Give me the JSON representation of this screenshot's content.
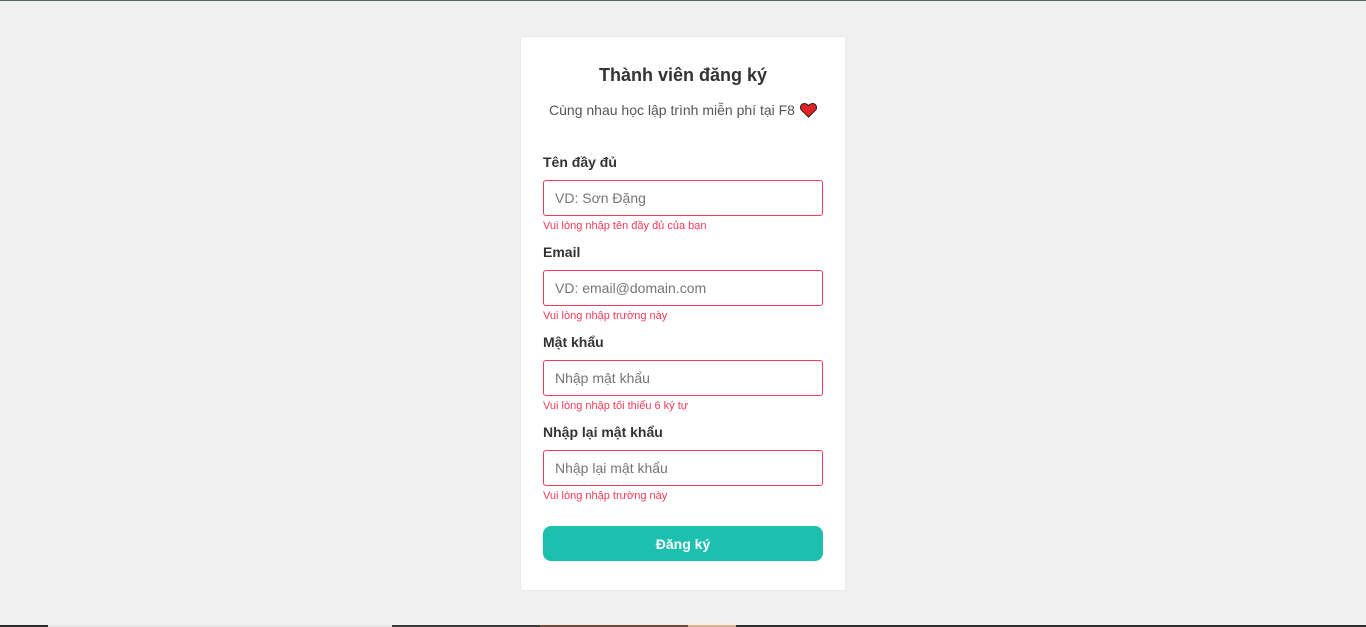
{
  "form": {
    "title": "Thành viên đăng ký",
    "description": "Cùng nhau học lập trình miễn phí tại F8",
    "fields": [
      {
        "label": "Tên đầy đủ",
        "placeholder": "VD: Sơn Đặng",
        "value": "",
        "message": "Vui lòng nhập tên đầy đủ của bạn"
      },
      {
        "label": "Email",
        "placeholder": "VD: email@domain.com",
        "value": "",
        "message": "Vui lòng nhập trường này"
      },
      {
        "label": "Mật khẩu",
        "placeholder": "Nhập mật khẩu",
        "value": "",
        "message": "Vui lòng nhập tối thiểu 6 ký tự"
      },
      {
        "label": "Nhập lại mật khẩu",
        "placeholder": "Nhập lại mật khẩu",
        "value": "",
        "message": "Vui lòng nhập trường này"
      }
    ],
    "submit_label": "Đăng ký"
  },
  "icons": {
    "heart": "heart-icon"
  },
  "colors": {
    "background": "#f0f0f0",
    "card": "#ffffff",
    "error": "#f33a58",
    "primary": "#1dbfaf"
  }
}
